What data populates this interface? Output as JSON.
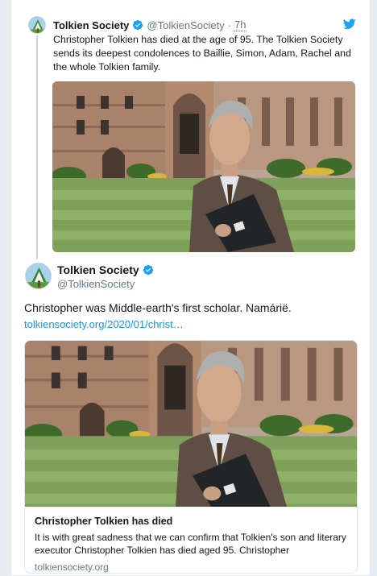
{
  "colors": {
    "accent": "#1b95e0",
    "verified": "#1da1f2",
    "muted": "#657786",
    "border": "#e1e8ed"
  },
  "icons": {
    "bird": "twitter-bird-icon",
    "verified": "verified-badge-icon"
  },
  "parent_tweet": {
    "name": "Tolkien Society",
    "handle": "@TolkienSociety",
    "separator": "·",
    "time": "7h",
    "text": "Christopher Tolkien has died at the age of 95. The Tolkien Society sends its deepest condolences to Baillie, Simon, Adam, Rachel and the whole Tolkien family."
  },
  "main_tweet": {
    "name": "Tolkien Society",
    "handle": "@TolkienSociety",
    "text": "Christopher was Middle-earth's first scholar. Namárië.",
    "link": "tolkiensociety.org/2020/01/christ…",
    "card": {
      "title": "Christopher Tolkien has died",
      "description": "It is with great sadness that we can confirm that Tolkien's son and literary executor Christopher Tolkien has died aged 95. Christopher",
      "domain": "tolkiensociety.org"
    }
  }
}
